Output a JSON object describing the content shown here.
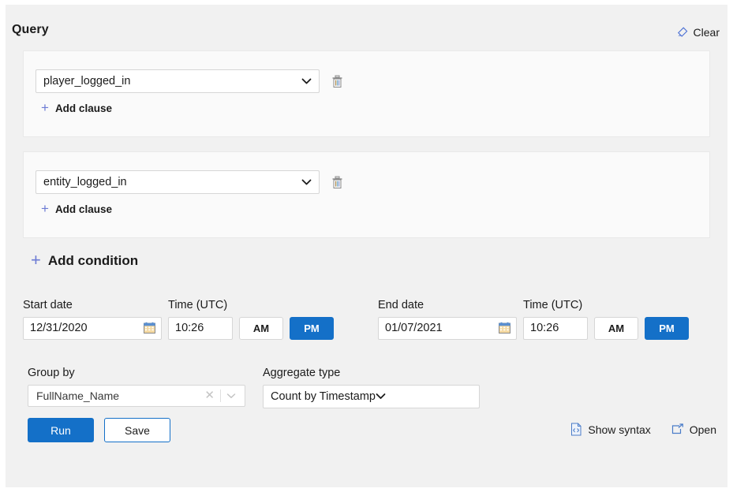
{
  "panel": {
    "title": "Query",
    "clear_label": "Clear",
    "clear_icon": "eraser-icon"
  },
  "conditions": [
    {
      "field_value": "player_logged_in",
      "delete_icon": "trash-icon",
      "add_clause_label": "Add clause",
      "add_clause_icon": "plus-icon"
    },
    {
      "field_value": "entity_logged_in",
      "delete_icon": "trash-icon",
      "add_clause_label": "Add clause",
      "add_clause_icon": "plus-icon"
    }
  ],
  "add_condition": {
    "label": "Add condition",
    "icon": "plus-icon"
  },
  "datetime": {
    "start": {
      "date_label": "Start date",
      "date_value": "12/31/2020",
      "date_icon": "calendar-icon",
      "time_label": "Time (UTC)",
      "time_value": "10:26",
      "am_label": "AM",
      "pm_label": "PM",
      "meridiem_selected": "PM"
    },
    "end": {
      "date_label": "End date",
      "date_value": "01/07/2021",
      "date_icon": "calendar-icon",
      "time_label": "Time (UTC)",
      "time_value": "10:26",
      "am_label": "AM",
      "pm_label": "PM",
      "meridiem_selected": "PM"
    }
  },
  "group_by": {
    "label": "Group by",
    "value": "FullName_Name",
    "clear_icon": "close-icon",
    "chevron_icon": "chevron-down-icon"
  },
  "aggregate": {
    "label": "Aggregate type",
    "value": "Count by Timestamp",
    "chevron_icon": "chevron-down-icon"
  },
  "actions": {
    "run_label": "Run",
    "save_label": "Save",
    "show_syntax_label": "Show syntax",
    "show_syntax_icon": "code-file-icon",
    "open_label": "Open",
    "open_icon": "external-open-icon"
  },
  "colors": {
    "accent_blue": "#1470c8",
    "page_background": "#f1f1f1",
    "card_background": "#fafafa",
    "plus_purple": "#6c7bd4"
  }
}
